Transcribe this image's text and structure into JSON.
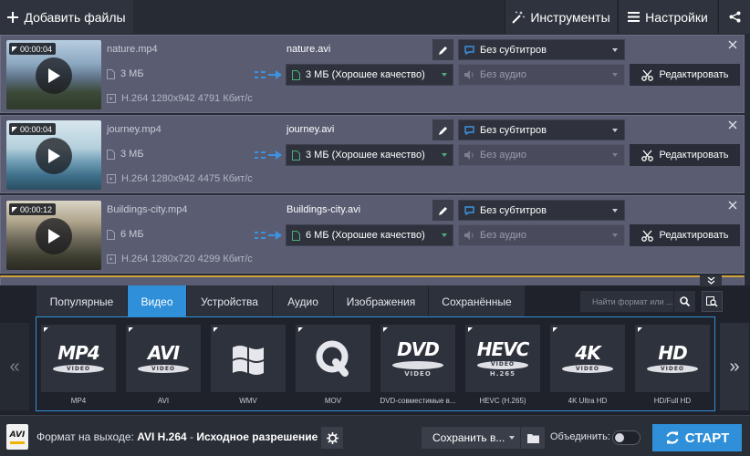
{
  "toolbar": {
    "add_files": "Добавить файлы",
    "tools": "Инструменты",
    "settings": "Настройки"
  },
  "files": [
    {
      "duration": "00:00:04",
      "source_name": "nature.mp4",
      "source_size": "3 МБ",
      "source_meta": "H.264 1280x942 4791 Кбит/с",
      "output_name": "nature.avi",
      "quality": "3 МБ (Хорошее качество)",
      "subtitles": "Без субтитров",
      "audio": "Без аудио",
      "edit_label": "Редактировать"
    },
    {
      "duration": "00:00:04",
      "source_name": "journey.mp4",
      "source_size": "3 МБ",
      "source_meta": "H.264 1280x942 4475 Кбит/с",
      "output_name": "journey.avi",
      "quality": "3 МБ (Хорошее качество)",
      "subtitles": "Без субтитров",
      "audio": "Без аудио",
      "edit_label": "Редактировать"
    },
    {
      "duration": "00:00:12",
      "source_name": "Buildings-city.mp4",
      "source_size": "6 МБ",
      "source_meta": "H.264 1280x720 4299 Кбит/с",
      "output_name": "Buildings-city.avi",
      "quality": "6 МБ (Хорошее качество)",
      "subtitles": "Без субтитров",
      "audio": "Без аудио",
      "edit_label": "Редактировать"
    }
  ],
  "format_tabs": [
    {
      "label": "Популярные",
      "active": false
    },
    {
      "label": "Видео",
      "active": true
    },
    {
      "label": "Устройства",
      "active": false
    },
    {
      "label": "Аудио",
      "active": false
    },
    {
      "label": "Изображения",
      "active": false
    },
    {
      "label": "Сохранённые",
      "active": false
    }
  ],
  "format_search": {
    "placeholder": "Найти формат или ..."
  },
  "formats": [
    {
      "logo": "MP4",
      "disc": "VIDEO",
      "sub": "",
      "label": "MP4"
    },
    {
      "logo": "AVI",
      "disc": "VIDEO",
      "sub": "",
      "label": "AVI"
    },
    {
      "logo": "",
      "disc": "",
      "sub": "",
      "label": "WMV"
    },
    {
      "logo": "Q",
      "disc": "",
      "sub": "",
      "label": "MOV"
    },
    {
      "logo": "DVD",
      "disc": "",
      "sub": "VIDEO",
      "label": "DVD-совместимые в..."
    },
    {
      "logo": "HEVC",
      "disc": "VIDEO",
      "sub": "H.265",
      "label": "HEVC (H.265)"
    },
    {
      "logo": "4K",
      "disc": "VIDEO",
      "sub": "",
      "label": "4K Ultra HD"
    },
    {
      "logo": "HD",
      "disc": "VIDEO",
      "sub": "",
      "label": "HD/Full HD"
    }
  ],
  "bottom": {
    "output_icon_text": "AVI",
    "output_prefix": "Формат на выходе: ",
    "output_format": "AVI H.264",
    "output_sep": " - ",
    "output_resolution": "Исходное разрешение",
    "save_to": "Сохранить в...",
    "merge": "Объединить:",
    "merge_on": false,
    "start": "СТАРТ"
  },
  "colors": {
    "accent": "#2f8fd8",
    "row_bg": "#5a5c72",
    "selected_border": "#d0a43a"
  }
}
